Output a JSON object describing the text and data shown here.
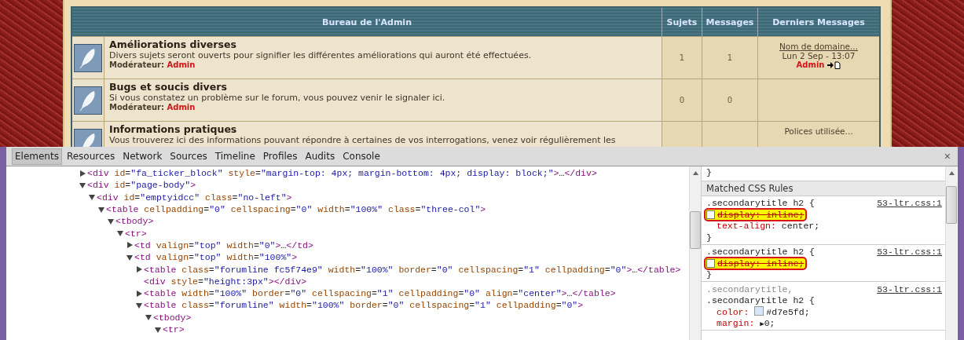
{
  "forum": {
    "section_title": "Bureau de l'Admin",
    "columns": [
      "Sujets",
      "Messages",
      "Derniers Messages"
    ],
    "rows": [
      {
        "title": "Améliorations diverses",
        "description": "Divers sujets seront ouverts pour signifier les différentes améliorations qui auront été effectuées.",
        "moderator_label": "Modérateur:",
        "moderator": "Admin",
        "topics": "1",
        "posts": "1",
        "last_post": {
          "title": "Nom de domaine...",
          "date": "Lun 2 Sep - 13:07",
          "author": "Admin"
        }
      },
      {
        "title": "Bugs et soucis divers",
        "description": "Si vous constatez un problème sur le forum, vous pouvez venir le signaler ici.",
        "moderator_label": "Modérateur:",
        "moderator": "Admin",
        "topics": "0",
        "posts": "0"
      },
      {
        "title": "Informations pratiques",
        "description": "Vous trouverez ici des informations pouvant répondre à certaines de vos interrogations, venez voir régulièrement les",
        "last_post": {
          "title": "Polices utilisée..."
        }
      }
    ]
  },
  "devtools": {
    "tabs": [
      {
        "label": "Elements",
        "selected": true
      },
      {
        "label": "Resources",
        "selected": false
      },
      {
        "label": "Network",
        "selected": false
      },
      {
        "label": "Sources",
        "selected": false
      },
      {
        "label": "Timeline",
        "selected": false
      },
      {
        "label": "Profiles",
        "selected": false
      },
      {
        "label": "Audits",
        "selected": false
      },
      {
        "label": "Console",
        "selected": false
      }
    ],
    "close": "×",
    "dom_tree": [
      {
        "kind": "toggle",
        "expanded": false,
        "text": "<div id=\"fa_ticker_block\" style=\"margin-top: 4px; margin-bottom: 4px; display: block;\">…</div>"
      },
      {
        "kind": "toggle",
        "expanded": true,
        "text": "<div id=\"page-body\">",
        "children": [
          {
            "kind": "toggle",
            "expanded": true,
            "text": "<div id=\"emptyidcc\" class=\"no-left\">",
            "children": [
              {
                "kind": "toggle",
                "expanded": true,
                "text": "<table cellpadding=\"0\" cellspacing=\"0\" width=\"100%\" class=\"three-col\">",
                "children": [
                  {
                    "kind": "toggle",
                    "expanded": true,
                    "text": "<tbody>",
                    "children": [
                      {
                        "kind": "toggle",
                        "expanded": true,
                        "text": "<tr>",
                        "children": [
                          {
                            "kind": "toggle",
                            "expanded": false,
                            "text": "<td valign=\"top\" width=\"0\">…</td>"
                          },
                          {
                            "kind": "toggle",
                            "expanded": true,
                            "text": "<td valign=\"top\" width=\"100%\">",
                            "children": [
                              {
                                "kind": "toggle",
                                "expanded": false,
                                "text": "<table class=\"forumline fc5f74e9\" width=\"100%\" border=\"0\" cellspacing=\"1\" cellpadding=\"0\">…</table>"
                              },
                              {
                                "kind": "plain",
                                "text": "<div style=\"height:3px\"></div>"
                              },
                              {
                                "kind": "toggle",
                                "expanded": false,
                                "text": "<table width=\"100%\" border=\"0\" cellspacing=\"1\" cellpadding=\"0\" align=\"center\">…</table>"
                              },
                              {
                                "kind": "toggle",
                                "expanded": true,
                                "text": "<table class=\"forumline\" width=\"100%\" border=\"0\" cellspacing=\"1\" cellpadding=\"0\">",
                                "children": [
                                  {
                                    "kind": "toggle",
                                    "expanded": true,
                                    "text": "<tbody>",
                                    "children": [
                                      {
                                        "kind": "toggle",
                                        "expanded": true,
                                        "text": "<tr>"
                                      }
                                    ]
                                  }
                                ]
                              }
                            ]
                          }
                        ]
                      }
                    ]
                  }
                ]
              }
            ]
          }
        ]
      }
    ],
    "styles": {
      "element_style_end": "}",
      "section_title": "Matched CSS Rules",
      "rules": [
        {
          "selectors": [
            {
              "text": ".secondarytitle h2 {",
              "matched": true
            }
          ],
          "source": "53-ltr.css:1",
          "properties": [
            {
              "name": "display:",
              "value": "inline;",
              "enabled": false,
              "highlighted": true
            },
            {
              "name": "text-align:",
              "value": "center;",
              "enabled": true,
              "highlighted": false
            }
          ],
          "end": "}"
        },
        {
          "selectors": [
            {
              "text": ".secondarytitle h2 {",
              "matched": true
            }
          ],
          "source": "53-ltr.css:1",
          "properties": [
            {
              "name": "display:",
              "value": "inline;",
              "enabled": false,
              "highlighted": true
            }
          ],
          "end": "}"
        },
        {
          "selectors": [
            {
              "text": ".secondarytitle,",
              "matched": false
            },
            {
              "text": ".secondarytitle h2 {",
              "matched": true
            }
          ],
          "source": "53-ltr.css:1",
          "properties": [
            {
              "kind": "color",
              "name": "color:",
              "value": "#d7e5fd;",
              "enabled": true,
              "highlighted": false
            },
            {
              "kind": "expandable",
              "name": "margin:",
              "toggle": "▶",
              "value": "0;",
              "enabled": true,
              "highlighted": false
            }
          ]
        }
      ]
    }
  }
}
